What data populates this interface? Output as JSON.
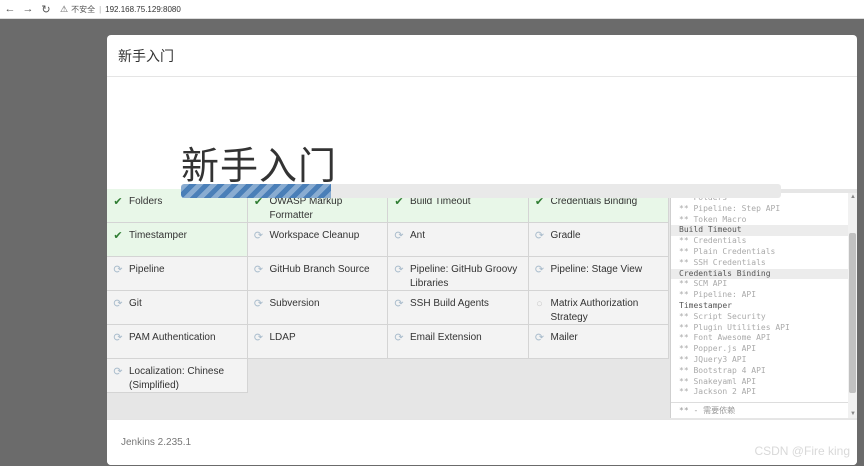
{
  "browser": {
    "back_icon": "arrow-left-icon",
    "forward_icon": "arrow-right-icon",
    "reload_icon": "reload-icon",
    "security_label": "不安全",
    "url": "192.168.75.129:8080"
  },
  "dialog": {
    "header_title": "新手入门",
    "hero_title": "新手入门",
    "progress_fraction": 0.25,
    "footer_version": "Jenkins 2.235.1"
  },
  "plugins": [
    {
      "name": "Folders",
      "status": "success"
    },
    {
      "name": "OWASP Markup Formatter",
      "status": "success"
    },
    {
      "name": "Build Timeout",
      "status": "success"
    },
    {
      "name": "Credentials Binding",
      "status": "success"
    },
    {
      "name": "Timestamper",
      "status": "success"
    },
    {
      "name": "Workspace Cleanup",
      "status": "progress"
    },
    {
      "name": "Ant",
      "status": "progress"
    },
    {
      "name": "Gradle",
      "status": "progress"
    },
    {
      "name": "Pipeline",
      "status": "progress"
    },
    {
      "name": "GitHub Branch Source",
      "status": "progress"
    },
    {
      "name": "Pipeline: GitHub Groovy Libraries",
      "status": "progress"
    },
    {
      "name": "Pipeline: Stage View",
      "status": "progress"
    },
    {
      "name": "Git",
      "status": "progress"
    },
    {
      "name": "Subversion",
      "status": "progress"
    },
    {
      "name": "SSH Build Agents",
      "status": "progress"
    },
    {
      "name": "Matrix Authorization Strategy",
      "status": "pending"
    },
    {
      "name": "PAM Authentication",
      "status": "progress"
    },
    {
      "name": "LDAP",
      "status": "progress"
    },
    {
      "name": "Email Extension",
      "status": "progress"
    },
    {
      "name": "Mailer",
      "status": "progress"
    },
    {
      "name": "Localization: Chinese (Simplified)",
      "status": "progress"
    }
  ],
  "log": {
    "lines": [
      {
        "text": "** Folders",
        "style": "faded"
      },
      {
        "text": "** Pipeline: Step API",
        "style": "faded"
      },
      {
        "text": "** Token Macro",
        "style": "faded"
      },
      {
        "text": "Build Timeout",
        "style": "head"
      },
      {
        "text": "** Credentials",
        "style": "faded"
      },
      {
        "text": "** Plain Credentials",
        "style": "faded"
      },
      {
        "text": "** SSH Credentials",
        "style": "faded"
      },
      {
        "text": "Credentials Binding",
        "style": "head"
      },
      {
        "text": "** SCM API",
        "style": "faded"
      },
      {
        "text": "** Pipeline: API",
        "style": "faded"
      },
      {
        "text": "Timestamper",
        "style": "plain"
      },
      {
        "text": "** Script Security",
        "style": "faded"
      },
      {
        "text": "** Plugin Utilities API",
        "style": "faded"
      },
      {
        "text": "** Font Awesome API",
        "style": "faded"
      },
      {
        "text": "** Popper.js API",
        "style": "faded"
      },
      {
        "text": "** JQuery3 API",
        "style": "faded"
      },
      {
        "text": "** Bootstrap 4 API",
        "style": "faded"
      },
      {
        "text": "** Snakeyaml API",
        "style": "faded"
      },
      {
        "text": "** Jackson 2 API",
        "style": "faded"
      }
    ],
    "footer": "** - 需要依赖"
  },
  "watermark": "CSDN @Fire king",
  "icons": {
    "success": "checkmark-icon",
    "progress": "refresh-spinner-icon",
    "pending": "circle-icon"
  },
  "colors": {
    "success_bg": "#e8f7e8",
    "check": "#2f7d32",
    "progress_bar": "#4a7fb8"
  }
}
